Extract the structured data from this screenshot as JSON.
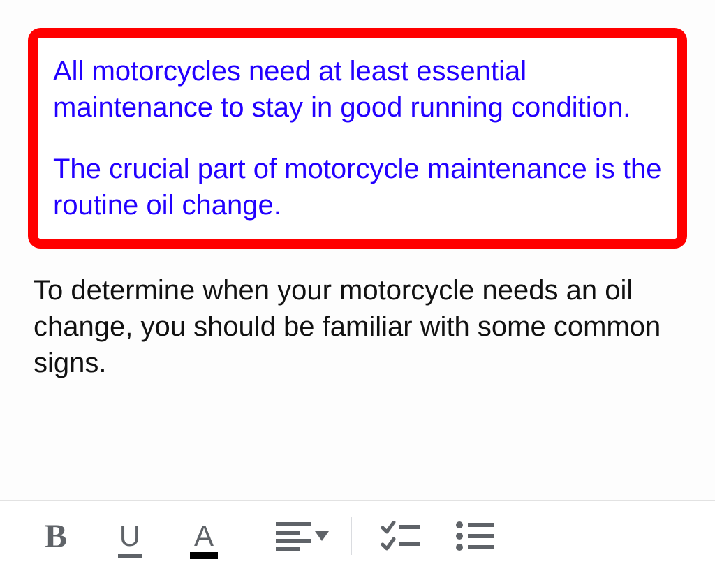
{
  "editor": {
    "highlighted": {
      "para1": "All motorcycles need at least essential maintenance to stay in good running condition.",
      "para2": "The crucial part of motorcycle maintenance is the routine oil change."
    },
    "para3": "To determine when your motorcycle needs an oil change, you should be familiar with some common signs."
  },
  "toolbar": {
    "bold": "B",
    "underline": "U",
    "textcolor": "A"
  }
}
